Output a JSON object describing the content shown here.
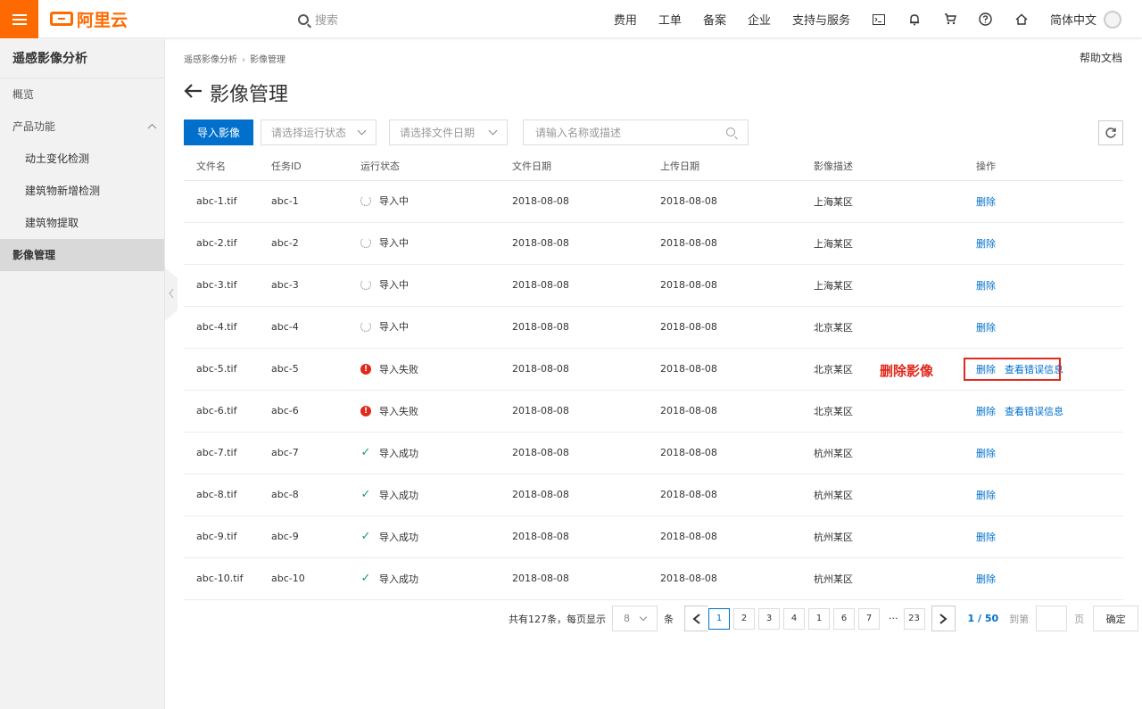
{
  "header": {
    "logo_text": "阿里云",
    "search_placeholder": "搜索",
    "nav": [
      "费用",
      "工单",
      "备案",
      "企业",
      "支持与服务"
    ],
    "language": "简体中文",
    "icons": [
      "terminal-icon",
      "bell-icon",
      "cart-icon",
      "help-icon",
      "home-icon"
    ]
  },
  "sidebar": {
    "title": "遥感影像分析",
    "items": [
      {
        "label": "概览"
      },
      {
        "label": "产品功能"
      },
      {
        "label": "动土变化检测"
      },
      {
        "label": "建筑物新增检测"
      },
      {
        "label": "建筑物提取"
      },
      {
        "label": "影像管理"
      }
    ]
  },
  "breadcrumb": [
    "遥感影像分析",
    "影像管理"
  ],
  "help_link": "帮助文档",
  "page_title": "影像管理",
  "toolbar": {
    "import_label": "导入影像",
    "status_placeholder": "请选择运行状态",
    "date_placeholder": "请选择文件日期",
    "search_placeholder": "请输入名称或描述"
  },
  "table": {
    "columns": [
      "文件名",
      "任务ID",
      "运行状态",
      "文件日期",
      "上传日期",
      "影像描述",
      "操作"
    ],
    "rows": [
      {
        "file": "abc-1.tif",
        "id": "abc-1",
        "status": "导入中",
        "file_date": "2018-08-08",
        "upload_date": "2018-08-08",
        "desc": "上海某区",
        "actions": [
          "删除"
        ]
      },
      {
        "file": "abc-2.tif",
        "id": "abc-2",
        "status": "导入中",
        "file_date": "2018-08-08",
        "upload_date": "2018-08-08",
        "desc": "上海某区",
        "actions": [
          "删除"
        ]
      },
      {
        "file": "abc-3.tif",
        "id": "abc-3",
        "status": "导入中",
        "file_date": "2018-08-08",
        "upload_date": "2018-08-08",
        "desc": "上海某区",
        "actions": [
          "删除"
        ]
      },
      {
        "file": "abc-4.tif",
        "id": "abc-4",
        "status": "导入中",
        "file_date": "2018-08-08",
        "upload_date": "2018-08-08",
        "desc": "北京某区",
        "actions": [
          "删除"
        ]
      },
      {
        "file": "abc-5.tif",
        "id": "abc-5",
        "status": "导入失败",
        "file_date": "2018-08-08",
        "upload_date": "2018-08-08",
        "desc": "北京某区",
        "actions": [
          "删除",
          "查看错误信息"
        ]
      },
      {
        "file": "abc-6.tif",
        "id": "abc-6",
        "status": "导入失败",
        "file_date": "2018-08-08",
        "upload_date": "2018-08-08",
        "desc": "北京某区",
        "actions": [
          "删除",
          "查看错误信息"
        ]
      },
      {
        "file": "abc-7.tif",
        "id": "abc-7",
        "status": "导入成功",
        "file_date": "2018-08-08",
        "upload_date": "2018-08-08",
        "desc": "杭州某区",
        "actions": [
          "删除"
        ]
      },
      {
        "file": "abc-8.tif",
        "id": "abc-8",
        "status": "导入成功",
        "file_date": "2018-08-08",
        "upload_date": "2018-08-08",
        "desc": "杭州某区",
        "actions": [
          "删除"
        ]
      },
      {
        "file": "abc-9.tif",
        "id": "abc-9",
        "status": "导入成功",
        "file_date": "2018-08-08",
        "upload_date": "2018-08-08",
        "desc": "杭州某区",
        "actions": [
          "删除"
        ]
      },
      {
        "file": "abc-10.tif",
        "id": "abc-10",
        "status": "导入成功",
        "file_date": "2018-08-08",
        "upload_date": "2018-08-08",
        "desc": "杭州某区",
        "actions": [
          "删除"
        ]
      }
    ]
  },
  "annotation": {
    "label": "删除影像",
    "row_index": 4
  },
  "pagination": {
    "total_text": "共有127条，每页显示",
    "page_size": "8",
    "unit": "条",
    "pages": [
      "1",
      "2",
      "3",
      "4",
      "1",
      "6",
      "7"
    ],
    "current": "1",
    "ellipsis": "···",
    "last": "23",
    "page_info": "1 / 50",
    "goto_label": "到第",
    "page_unit": "页",
    "confirm_label": "确定"
  },
  "colors": {
    "brand": "#ff6a00",
    "primary": "#0070cc",
    "error": "#e0291c",
    "success": "#1aa05b"
  }
}
